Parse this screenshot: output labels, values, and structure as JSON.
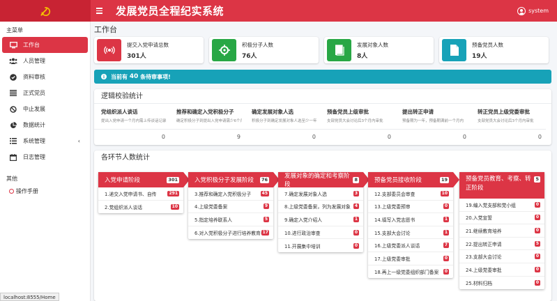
{
  "app": {
    "title": "发展党员全程纪实系统",
    "user": "system",
    "status_url": "localhost:8555/Home"
  },
  "sidebar": {
    "heading": "主菜单",
    "items": [
      {
        "label": "工作台",
        "icon": "monitor-icon",
        "active": true
      },
      {
        "label": "人员管理",
        "icon": "users-icon"
      },
      {
        "label": "资料审核",
        "icon": "check-circle-icon"
      },
      {
        "label": "正式党员",
        "icon": "list-icon"
      },
      {
        "label": "中止发展",
        "icon": "ban-icon"
      },
      {
        "label": "数据统计",
        "icon": "pie-chart-icon"
      },
      {
        "label": "系统管理",
        "icon": "list-check-icon",
        "chevron": "‹"
      },
      {
        "label": "日志管理",
        "icon": "calendar-icon"
      }
    ],
    "other_heading": "其他",
    "manual": "操作手册"
  },
  "page_title": "工作台",
  "info_boxes": [
    {
      "label": "提交入党申请总数",
      "value": "301人",
      "color": "#dc3545",
      "icon": "broadcast-icon"
    },
    {
      "label": "积极分子人数",
      "value": "76人",
      "color": "#28a745",
      "icon": "crosshair-icon"
    },
    {
      "label": "发展对象人数",
      "value": "8人",
      "color": "#28a745",
      "icon": "book-icon"
    },
    {
      "label": "预备党员人数",
      "value": "19人",
      "color": "#17a2b8",
      "icon": "file-icon"
    }
  ],
  "alert": {
    "prefix": "当前有",
    "count": "40",
    "suffix": "条待审事项!"
  },
  "logic_card": {
    "title": "逻辑校验统计",
    "items": [
      {
        "name": "党组织派人谈话",
        "desc": "提出入党申请一个月内需上传谈话记录",
        "value": "0"
      },
      {
        "name": "推荐和确定入党积极分子",
        "desc": "确定积极分子到提出入党申请需少6个月以上",
        "value": "9"
      },
      {
        "name": "确定发展对象人选",
        "desc": "积极分子到确定发展对象人选至少一年",
        "value": "0"
      },
      {
        "name": "预备党员上级审批",
        "desc": "支部党员大会讨论后3个月内审批",
        "value": "0"
      },
      {
        "name": "提出转正申请",
        "desc": "预备期为一年，预备期满前一个月内",
        "value": "0"
      },
      {
        "name": "转正党员上级党委审批",
        "desc": "支部党员大会讨论后3个月内审批",
        "value": "0"
      }
    ]
  },
  "stages_card": {
    "title": "各环节人数统计",
    "stages": [
      {
        "title": "入党申请阶段",
        "count": "301",
        "items": [
          {
            "label": "1.递交入党申请书、自传",
            "count": "291"
          },
          {
            "label": "2.党组织派人谈话",
            "count": "10"
          }
        ]
      },
      {
        "title": "入党积极分子发展阶段",
        "count": "76",
        "items": [
          {
            "label": "3.推荐和确定入党积极分子",
            "count": "45"
          },
          {
            "label": "4.上级党委备案",
            "count": "9"
          },
          {
            "label": "5.指定培养联系人",
            "count": "5"
          },
          {
            "label": "6.对入党积极分子进行培养教育考察",
            "count": "17"
          }
        ]
      },
      {
        "title": "发展对象的确定和考察阶段",
        "count": "8",
        "items": [
          {
            "label": "7.确定发展对象人选",
            "count": "3"
          },
          {
            "label": "8.上级党委备案，列为发展对象",
            "count": "4"
          },
          {
            "label": "9.确定入党介绍人",
            "count": "1"
          },
          {
            "label": "10.进行政治审查",
            "count": "0"
          },
          {
            "label": "11.开展集中培训",
            "count": "0"
          }
        ]
      },
      {
        "title": "预备党员接收阶段",
        "count": "19",
        "items": [
          {
            "label": "12.支部委员会审查",
            "count": "10"
          },
          {
            "label": "13.上级党委预审",
            "count": "0"
          },
          {
            "label": "14.填写入党志愿书",
            "count": "1"
          },
          {
            "label": "15.支部大会讨论",
            "count": "1"
          },
          {
            "label": "16.上级党委派人谈话",
            "count": "7"
          },
          {
            "label": "17.上级党委审批",
            "count": "0"
          },
          {
            "label": "18.再上一级党委组织部门备案",
            "count": "0"
          }
        ]
      },
      {
        "title": "预备党员教育、考察、转正阶段",
        "count": "5",
        "items": [
          {
            "label": "19.编入党支部和党小组",
            "count": "0"
          },
          {
            "label": "20.入党宣誓",
            "count": "0"
          },
          {
            "label": "21.继续教育培养",
            "count": "0"
          },
          {
            "label": "22.提出转正申请",
            "count": "5"
          },
          {
            "label": "23.支部大会讨论",
            "count": "0"
          },
          {
            "label": "24.上级党委审批",
            "count": "0"
          },
          {
            "label": "25.材料归档",
            "count": "0"
          }
        ]
      }
    ]
  }
}
